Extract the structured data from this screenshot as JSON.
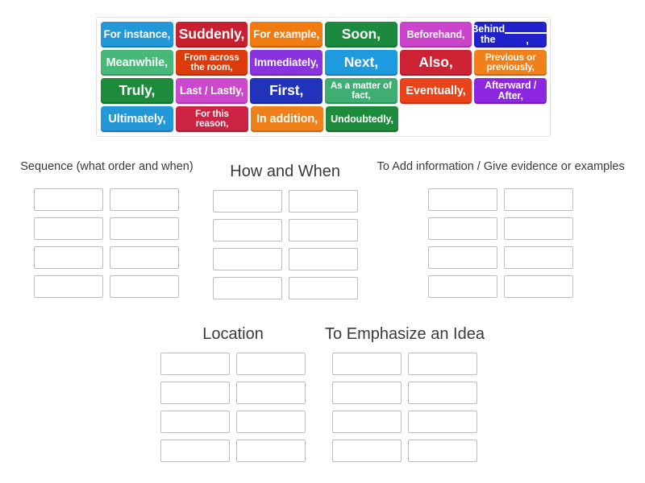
{
  "activity": {
    "type": "group-sort",
    "tile_rows": [
      [
        {
          "label": "For instance,",
          "color": "#2398d8",
          "size": "fs-14"
        },
        {
          "label": "Suddenly,",
          "color": "#c9202f",
          "size": "fs-18"
        },
        {
          "label": "For example,",
          "color": "#ef7b11",
          "size": "fs-14"
        },
        {
          "label": "Soon,",
          "color": "#1b8a3f",
          "size": "fs-18"
        },
        {
          "label": "Beforehand,",
          "color": "#cc44cc",
          "size": "fs-13"
        },
        {
          "label": "Behind the ____,",
          "color": "#2222cc",
          "size": "fs-13",
          "has_blank": true,
          "prefix": "Behind the"
        }
      ],
      [
        {
          "label": "Meanwhile,",
          "color": "#46b978",
          "size": "fs-15"
        },
        {
          "label": "From across the room,",
          "color": "#dd3b0c",
          "size": "fs-12"
        },
        {
          "label": "Immediately,",
          "color": "#8833dd",
          "size": "fs-14"
        },
        {
          "label": "Next,",
          "color": "#1e9ade",
          "size": "fs-18"
        },
        {
          "label": "Also,",
          "color": "#cc2233",
          "size": "fs-18"
        },
        {
          "label": "Previous or previously,",
          "color": "#f0801a",
          "size": "fs-12"
        }
      ],
      [
        {
          "label": "Truly,",
          "color": "#1e8a3c",
          "size": "fs-18"
        },
        {
          "label": "Last / Lastly,",
          "color": "#cc48cc",
          "size": "fs-14"
        },
        {
          "label": "First,",
          "color": "#2233bb",
          "size": "fs-18"
        },
        {
          "label": "As a matter of fact,",
          "color": "#3fae72",
          "size": "fs-12"
        },
        {
          "label": "Eventually,",
          "color": "#e8431a",
          "size": "fs-15"
        },
        {
          "label": "Afterward / After,",
          "color": "#8c26e0",
          "size": "fs-13"
        }
      ],
      [
        {
          "label": "Ultimately,",
          "color": "#2398d8",
          "size": "fs-15"
        },
        {
          "label": "For this reason,",
          "color": "#cc2244",
          "size": "fs-12"
        },
        {
          "label": "In addition,",
          "color": "#f0801a",
          "size": "fs-15"
        },
        {
          "label": "Undoubtedly,",
          "color": "#1e8a3c",
          "size": "fs-13"
        }
      ]
    ],
    "categories_upper": [
      {
        "title": "Sequence (what order and when)",
        "title_style": "small",
        "slots": 8
      },
      {
        "title": "How and When",
        "title_style": "large",
        "slots": 8
      },
      {
        "title": "To Add information / Give evidence or examples",
        "title_style": "small",
        "slots": 8
      }
    ],
    "categories_lower": [
      {
        "title": "Location",
        "title_style": "large",
        "slots": 8
      },
      {
        "title": "To Emphasize an Idea",
        "title_style": "large",
        "slots": 8
      }
    ]
  },
  "colors": {
    "page_background": "#ffffff",
    "tray_border": "#e2e2e2",
    "slot_border": "#bdbdbd",
    "title_text": "#3a3a3a"
  }
}
